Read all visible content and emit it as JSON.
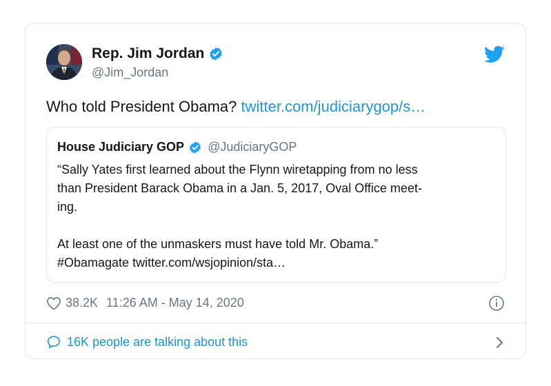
{
  "author": {
    "name": "Rep. Jim Jordan",
    "handle": "@Jim_Jordan"
  },
  "tweet": {
    "text": "Who told President Obama?",
    "link": "twitter.com/judiciarygop/s…"
  },
  "quote": {
    "name": "House Judiciary GOP",
    "handle": "@JudiciaryGOP",
    "line1": "“Sally Yates first learned about the Flynn wiretapping from no less",
    "line2": "than President Barack Obama in a Jan. 5, 2017, Oval Office meet-",
    "line3": "ing.",
    "line4": "At least one of the unmaskers must have told Mr. Obama.”",
    "line5": "#Obamagate twitter.com/wsjopinion/sta…"
  },
  "meta": {
    "likes": "38.2K",
    "timestamp": "11:26 AM - May 14, 2020"
  },
  "footer": {
    "talking": "16K people are talking about this"
  },
  "colors": {
    "accent": "#1da1f2",
    "link": "#1b95e0",
    "muted": "#657786",
    "border": "#e1e8ed"
  },
  "icons": {
    "verified": "verified-badge-icon",
    "bird": "twitter-bird-icon",
    "heart": "heart-icon",
    "info": "info-icon",
    "bubble": "speech-bubble-icon",
    "chevron": "chevron-right-icon"
  }
}
